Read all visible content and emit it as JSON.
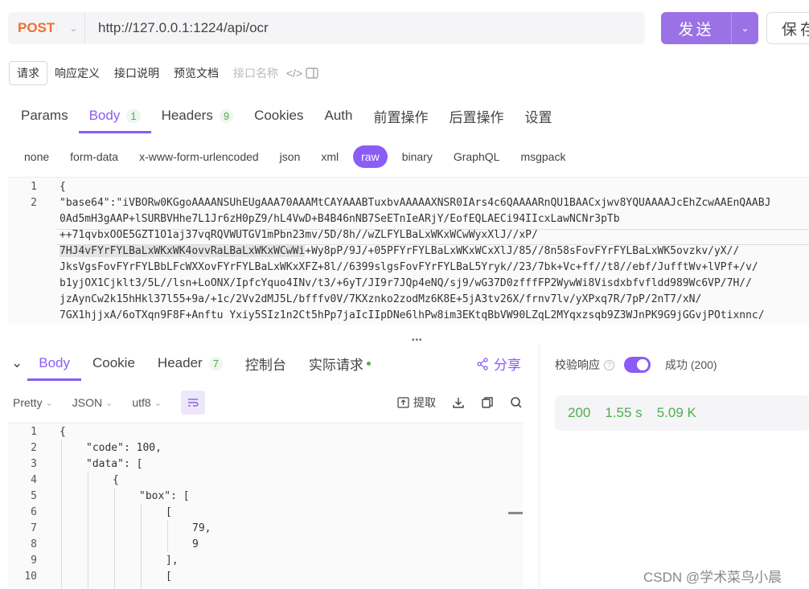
{
  "request": {
    "method": "POST",
    "url": "http://127.0.0.1:1224/api/ocr",
    "send_label": "发送",
    "save_label": "保存"
  },
  "subtabs": [
    "请求",
    "响应定义",
    "接口说明",
    "预览文档",
    "接口名称"
  ],
  "main_tabs": [
    {
      "label": "Params"
    },
    {
      "label": "Body",
      "badge": "1"
    },
    {
      "label": "Headers",
      "badge": "9"
    },
    {
      "label": "Cookies"
    },
    {
      "label": "Auth"
    },
    {
      "label": "前置操作"
    },
    {
      "label": "后置操作"
    },
    {
      "label": "设置"
    }
  ],
  "body_types": [
    "none",
    "form-data",
    "x-www-form-urlencoded",
    "json",
    "xml",
    "raw",
    "binary",
    "GraphQL",
    "msgpack"
  ],
  "request_body": {
    "line_numbers": [
      "1",
      "2"
    ],
    "lines": [
      "{",
      "\"base64\":\"iVBORw0KGgoAAAANSUhEUgAAA70AAAMtCAYAAABTuxbvAAAAAXNSR0IArs4c6QAAAARnQU1BAACxjwv8YQUAAAAJcEhZcwAAEnQAABJ",
      "0Ad5mH3gAAP+lSURBVHhe7L1Jr6zH0pZ9/hL4VwD+B4B46nNB7SeETnIeARjY/EofEQLAECi94IIcxLawNCNr3pTb",
      "++71qvbxOOE5GZT1O1aj37vqRQVWUTGV1mPbn23mv/5D/8h//wZLFYLBaLxWKxWCwWyxXlJ//xP/",
      "7HJ4vFYrFYLBaLxWKxWK4ovvRaLBaLxWKxWCwWi",
      "+Wy8pP/9J/+05PFYrFYLBaLxWKxWCxXlJ/85//8n58sFovFYrFYLBaLxWK5ovzkv/yX//",
      "JksVgsFovFYrFYLBbLFcWXXovFYrFYLBaLxWKxXFZ+8l//6399slgsFovFYrFYLBaL5Yryk//23/7bk+Vc+ff//t8//ebf/JufftWv+lVPf+/v/",
      "b1yjOX1Cjklt3/5L//lsn+LoONX/IpfcYquo4INv/t3/+6yT/JI9r7JQp4eNQ/sj9/wG37D0zfffFP2WywWi8Visdxbfvfldd989Wc6VP/7H//",
      "jzAynCw2k15hHkl37l55+9a/+1c/2Vv2dMJ5L/bfffv0V/7KXznko2zodMz6K8E+5jA3tv26X/frnv7lv/yXPxq7R/7pP/2nT7/xN/",
      "7GX1hjjxA/6oTXqn9F8F+Anftu Yxiy5SIz1n2Ct5hPp7jaIcIIpDNe6lhPw8im3EKtqBbVW90LZqL2MYqxzsqb9Z3WJnPK9G9jGGvjPOtixnnc/"
    ]
  },
  "response_tabs": [
    {
      "label": "Body"
    },
    {
      "label": "Cookie"
    },
    {
      "label": "Header",
      "badge": "7"
    },
    {
      "label": "控制台"
    },
    {
      "label": "实际请求"
    }
  ],
  "share_label": "分享",
  "response_tools": {
    "format": "Pretty",
    "lang": "JSON",
    "encoding": "utf8",
    "extract_label": "提取"
  },
  "response_body": {
    "line_numbers": [
      "1",
      "2",
      "3",
      "4",
      "5",
      "6",
      "7",
      "8",
      "9",
      "10"
    ],
    "lines": [
      "{",
      "\"code\": 100,",
      "\"data\": [",
      "{",
      "\"box\": [",
      "[",
      "79,",
      "9",
      "],",
      "["
    ]
  },
  "verify": {
    "label": "校验响应",
    "result": "成功 (200)"
  },
  "stats": {
    "status": "200",
    "time": "1.55 s",
    "size": "5.09 K"
  },
  "watermark": "CSDN @学术菜鸟小晨",
  "colors": {
    "accent": "#8b5cf6",
    "method": "#f56c2e",
    "success": "#4caf50"
  }
}
